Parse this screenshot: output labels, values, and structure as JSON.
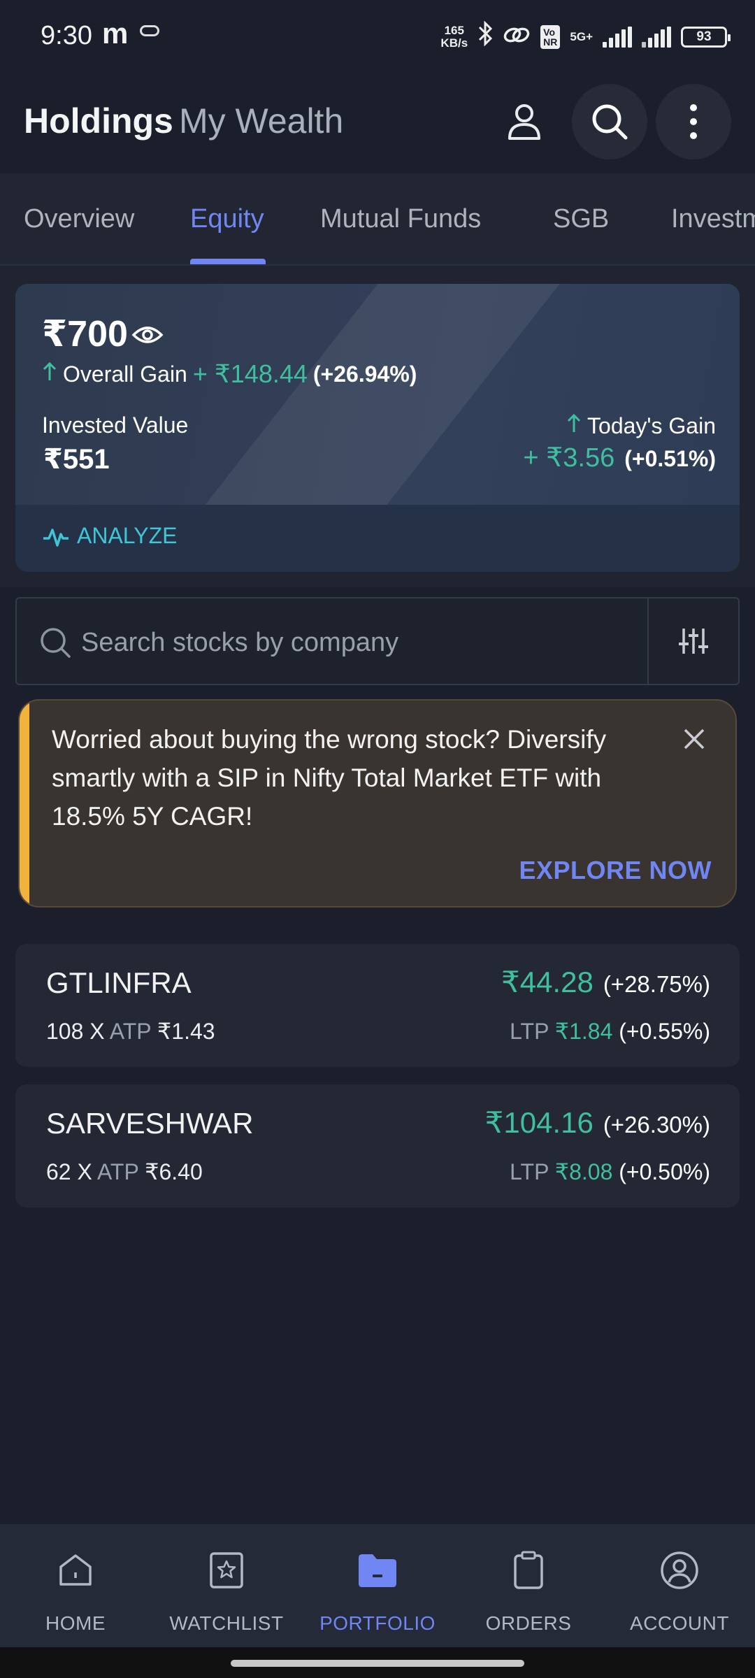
{
  "status_bar": {
    "time": "9:30",
    "app_glyph": "m",
    "speed_value": "165",
    "speed_unit": "KB/s",
    "network": "5G+",
    "volte": "Vo\nNR",
    "battery": "93"
  },
  "header": {
    "title": "Holdings",
    "subtitle": "My Wealth",
    "icons": [
      "profile-icon",
      "search-icon",
      "more-vertical-icon"
    ]
  },
  "tabs": [
    {
      "label": "Overview",
      "active": false
    },
    {
      "label": "Equity",
      "active": true
    },
    {
      "label": "Mutual Funds",
      "active": false
    },
    {
      "label": "SGB",
      "active": false
    },
    {
      "label": "Investm",
      "active": false
    }
  ],
  "summary": {
    "current_value": "₹700",
    "overall_gain_label": "Overall Gain",
    "overall_gain_value": "+ ₹148.44",
    "overall_gain_pct": "(+26.94%)",
    "invested_label": "Invested Value",
    "invested_value": "₹551",
    "today_gain_label": "Today's Gain",
    "today_gain_value": "+ ₹3.56",
    "today_gain_pct": "(+0.51%)",
    "analyze_label": "ANALYZE"
  },
  "search": {
    "placeholder": "Search stocks by company"
  },
  "promo": {
    "text": "Worried about buying the wrong stock? Diversify smartly with a SIP in Nifty Total Market ETF with 18.5% 5Y CAGR!",
    "cta": "EXPLORE NOW"
  },
  "holdings": [
    {
      "symbol": "GTLINFRA",
      "qty": "108",
      "x": "X",
      "atp_label": "ATP",
      "atp": "₹1.43",
      "value": "₹44.28",
      "value_pct": "(+28.75%)",
      "ltp_label": "LTP",
      "ltp": "₹1.84",
      "ltp_pct": "(+0.55%)"
    },
    {
      "symbol": "SARVESHWAR",
      "qty": "62",
      "x": "X",
      "atp_label": "ATP",
      "atp": "₹6.40",
      "value": "₹104.16",
      "value_pct": "(+26.30%)",
      "ltp_label": "LTP",
      "ltp": "₹8.08",
      "ltp_pct": "(+0.50%)"
    }
  ],
  "bottom_nav": [
    {
      "label": "HOME",
      "icon": "home-icon",
      "active": false
    },
    {
      "label": "WATCHLIST",
      "icon": "watchlist-star-icon",
      "active": false
    },
    {
      "label": "PORTFOLIO",
      "icon": "portfolio-folder-icon",
      "active": true
    },
    {
      "label": "ORDERS",
      "icon": "orders-clipboard-icon",
      "active": false
    },
    {
      "label": "ACCOUNT",
      "icon": "account-user-icon",
      "active": false
    }
  ],
  "colors": {
    "background": "#1b1f2b",
    "accent": "#6f86f3",
    "gain_green": "#3fbf9f",
    "promo_bg": "#3a3430",
    "promo_accent": "#f2b33d"
  }
}
